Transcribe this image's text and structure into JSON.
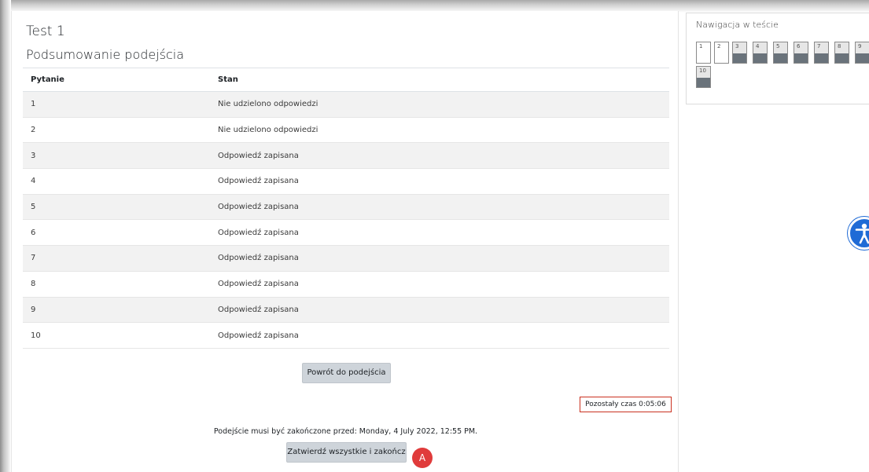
{
  "quiz": {
    "title": "Test 1",
    "summary_title": "Podsumowanie podejścia",
    "columns": [
      "Pytanie",
      "Stan"
    ],
    "rows": [
      {
        "question": "1",
        "status": "Nie udzielono odpowiedzi"
      },
      {
        "question": "2",
        "status": "Nie udzielono odpowiedzi"
      },
      {
        "question": "3",
        "status": "Odpowiedź zapisana"
      },
      {
        "question": "4",
        "status": "Odpowiedź zapisana"
      },
      {
        "question": "5",
        "status": "Odpowiedź zapisana"
      },
      {
        "question": "6",
        "status": "Odpowiedź zapisana"
      },
      {
        "question": "7",
        "status": "Odpowiedź zapisana"
      },
      {
        "question": "8",
        "status": "Odpowiedź zapisana"
      },
      {
        "question": "9",
        "status": "Odpowiedź zapisana"
      },
      {
        "question": "10",
        "status": "Odpowiedź zapisana"
      }
    ],
    "return_button": "Powrót do podejścia",
    "time_left": "Pozostały czas 0:05:06",
    "due_text": "Podejście musi być zakończone przed: Monday, 4 July 2022, 12:55 PM.",
    "submit_button": "Zatwierdź wszystkie i zakończ",
    "marker_label": "A"
  },
  "navigation": {
    "title": "Nawigacja w teście",
    "buttons": [
      {
        "label": "1",
        "answered": false
      },
      {
        "label": "2",
        "answered": false
      },
      {
        "label": "3",
        "answered": true
      },
      {
        "label": "4",
        "answered": true
      },
      {
        "label": "5",
        "answered": true
      },
      {
        "label": "6",
        "answered": true
      },
      {
        "label": "7",
        "answered": true
      },
      {
        "label": "8",
        "answered": true
      },
      {
        "label": "9",
        "answered": true
      },
      {
        "label": "10",
        "answered": true
      }
    ]
  },
  "accessibility": {
    "icon": "accessibility-icon",
    "color": "#1f6bd6"
  },
  "colors": {
    "accent_marker": "#e03b3b",
    "timer_border": "#ca3120",
    "answered_fill": "#6a737b"
  }
}
